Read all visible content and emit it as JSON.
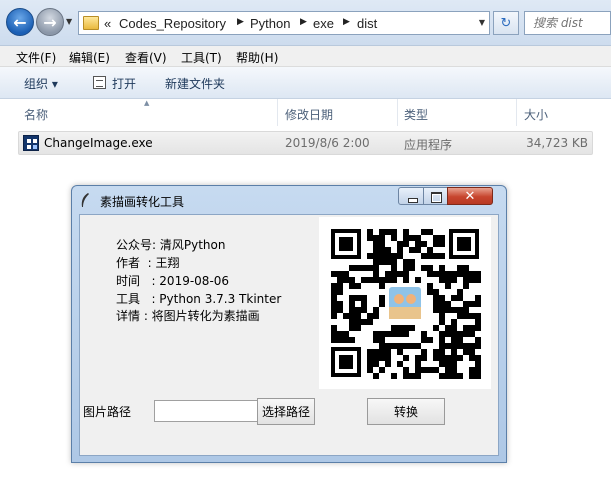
{
  "address_bar": {
    "breadcrumb_lead": "«",
    "crumbs": [
      "Codes_Repository",
      "Python",
      "exe",
      "dist"
    ],
    "search_placeholder": "搜索 dist"
  },
  "menu": [
    "文件(F)",
    "编辑(E)",
    "查看(V)",
    "工具(T)",
    "帮助(H)"
  ],
  "toolbar": {
    "organize": "组织 ▾",
    "open": "打开",
    "new_folder": "新建文件夹"
  },
  "columns": [
    "名称",
    "修改日期",
    "类型",
    "大小"
  ],
  "file": {
    "name": "ChangeImage.exe",
    "modified": "2019/8/6 2:00",
    "type": "应用程序",
    "size": "34,723 KB"
  },
  "tk_window": {
    "title": "素描画转化工具",
    "info_lines": [
      "公众号: 清风Python",
      "作者  : 王翔",
      "时间   : 2019-08-06",
      "工具   : Python 3.7.3 Tkinter",
      "详情 : 将图片转化为素描画"
    ],
    "path_label": "图片路径",
    "path_value": "",
    "select_button": "选择路径",
    "convert_button": "转换"
  },
  "colors": {
    "titlebar": "#b7cfea",
    "close_button": "#c7452e",
    "accent": "#2c6cbf"
  }
}
